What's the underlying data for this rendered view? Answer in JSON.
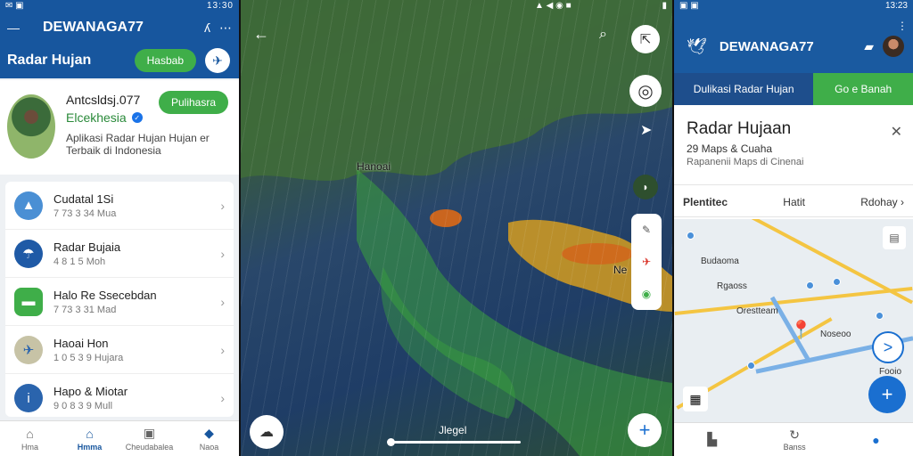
{
  "panel1": {
    "status_time": "13:30",
    "app_name": "DEWANAGA77",
    "title": "Radar Hujan",
    "header_button": "Hasbab",
    "profile": {
      "name": "Antcsldsj.077",
      "subtitle": "Elcekhesia",
      "description": "Aplikasi Radar Hujan Hujan er Terbaik di Indonesia",
      "follow_label": "Pulihasra"
    },
    "list": [
      {
        "title": "Cudatal 1Si",
        "sub": "7 73 3 34 Mua",
        "color": "#4a8fd4",
        "icon": "A"
      },
      {
        "title": "Radar Bujaia",
        "sub": "4 8 1 5 Moh",
        "color": "#1f5aa6",
        "icon": "☂"
      },
      {
        "title": "Halo Re Ssecebdan",
        "sub": "7 73 3 31 Mad",
        "color": "#3fae49",
        "icon": "■"
      },
      {
        "title": "Haoai Hon",
        "sub": "1 0 5 3 9 Hujara",
        "color": "#c7c3a6",
        "icon": "✈"
      },
      {
        "title": "Hapo & Miotar",
        "sub": "9 0 8 3 9 Mull",
        "color": "#2a64ad",
        "icon": "i"
      }
    ],
    "nav": [
      {
        "label": "Hma",
        "icon": "⌂"
      },
      {
        "label": "Hmma",
        "icon": "⌂"
      },
      {
        "label": "Cheudabalea",
        "icon": "▣"
      },
      {
        "label": "Naoa",
        "icon": "◆"
      }
    ]
  },
  "panel2": {
    "city_label": "Hanoai",
    "side_label": "Ne",
    "time_label": "Jlegel"
  },
  "panel3": {
    "status_time": "13:23",
    "app_name": "DEWANAGA77",
    "tab_left": "Dulikasi Radar Hujan",
    "tab_right": "Go e Banah",
    "info_title": "Radar Hujaan",
    "info_sub1": "29 Maps & Cuaha",
    "info_sub2": "Rapanenii Maps di Cinenai",
    "row_left": "Plentitec",
    "row_mid": "Hatit",
    "row_right": "Rdohay",
    "map_labels": [
      "Budaoma",
      "Rgaoss",
      "Orestteam",
      "Noseoo",
      "Fooio"
    ],
    "bottom": [
      "",
      "Banss",
      ""
    ]
  },
  "colors": {
    "primary": "#17569e",
    "accent": "#3fae49",
    "map_water": "#1f3d66"
  }
}
